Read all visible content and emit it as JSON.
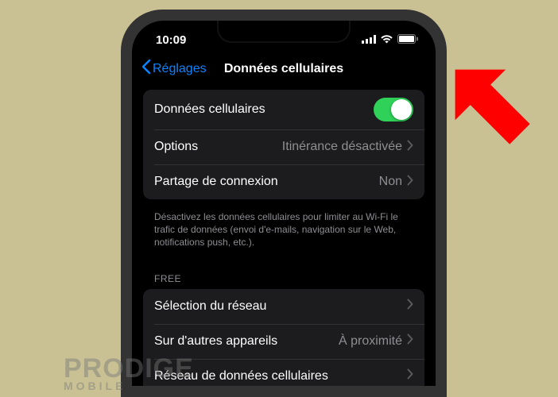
{
  "status": {
    "time": "10:09"
  },
  "nav": {
    "back": "Réglages",
    "title": "Données cellulaires"
  },
  "group1": {
    "cellular": {
      "label": "Données cellulaires",
      "on": true
    },
    "options": {
      "label": "Options",
      "value": "Itinérance désactivée"
    },
    "hotspot": {
      "label": "Partage de connexion",
      "value": "Non"
    }
  },
  "footer": "Désactivez les données cellulaires pour limiter au Wi-Fi le trafic de données (envoi d'e-mails, navigation sur le Web, notifications push, etc.).",
  "carrier": {
    "header": "FREE"
  },
  "group2": {
    "network": {
      "label": "Sélection du réseau"
    },
    "other_devices": {
      "label": "Sur d'autres appareils",
      "value": "À proximité"
    },
    "data_network": {
      "label": "Réseau de données cellulaires"
    }
  },
  "watermark": {
    "line1": "PRODIGE",
    "line2": "MOBILE"
  },
  "colors": {
    "accent": "#0a84ff",
    "switch_on": "#30d158",
    "arrow": "#ff0000"
  }
}
